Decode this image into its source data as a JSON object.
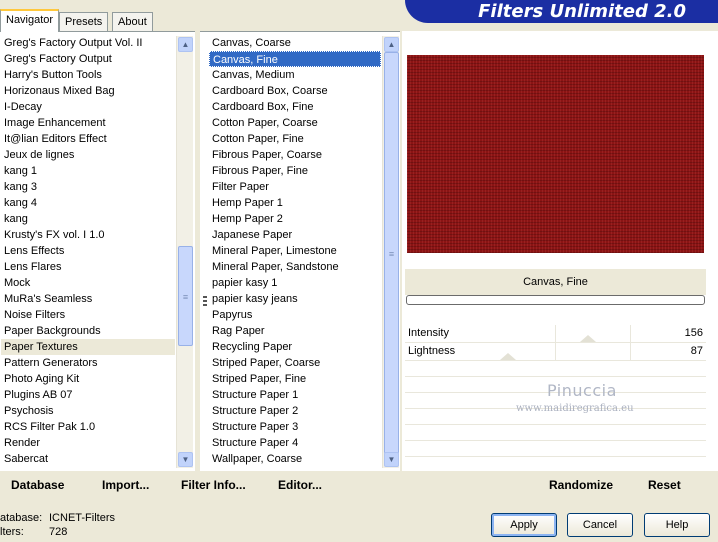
{
  "tabs": [
    "Navigator",
    "Presets",
    "About"
  ],
  "app_title": "Filters Unlimited 2.0",
  "categories": [
    "Greg's Factory Output Vol. II",
    "Greg's Factory Output",
    "Harry's Button Tools",
    "Horizonaus Mixed Bag",
    "I-Decay",
    "Image Enhancement",
    "It@lian Editors Effect",
    "Jeux de lignes",
    "kang 1",
    "kang 3",
    "kang 4",
    "kang",
    "Krusty's FX vol. I 1.0",
    "Lens Effects",
    "Lens Flares",
    "Mock",
    "MuRa's Seamless",
    "Noise Filters",
    "Paper Backgrounds",
    "Paper Textures",
    "Pattern Generators",
    "Photo Aging Kit",
    "Plugins AB 07",
    "Psychosis",
    "RCS Filter Pak 1.0",
    "Render",
    "Sabercat"
  ],
  "selected_category": "Paper Textures",
  "filters": [
    "Canvas, Coarse",
    "Canvas, Fine",
    "Canvas, Medium",
    "Cardboard Box, Coarse",
    "Cardboard Box, Fine",
    "Cotton Paper, Coarse",
    "Cotton Paper, Fine",
    "Fibrous Paper, Coarse",
    "Fibrous Paper, Fine",
    "Filter Paper",
    "Hemp Paper 1",
    "Hemp Paper 2",
    "Japanese Paper",
    "Mineral Paper, Limestone",
    "Mineral Paper, Sandstone",
    "papier kasy 1",
    "papier kasy jeans",
    "Papyrus",
    "Rag Paper",
    "Recycling Paper",
    "Striped Paper, Coarse",
    "Striped Paper, Fine",
    "Structure Paper 1",
    "Structure Paper 2",
    "Structure Paper 3",
    "Structure Paper 4",
    "Wallpaper, Coarse"
  ],
  "selected_filter": "Canvas, Fine",
  "preview": {
    "title": "Canvas, Fine",
    "texture_color": "#8b1414"
  },
  "sliders": [
    {
      "label": "Intensity",
      "value": "156"
    },
    {
      "label": "Lightness",
      "value": "87"
    }
  ],
  "watermark": {
    "line1": "Pinuccia",
    "line2": "www.maidiregrafica.eu"
  },
  "toolbar": {
    "database": "Database",
    "import": "Import...",
    "filter_info": "Filter Info...",
    "editor": "Editor...",
    "randomize": "Randomize",
    "reset": "Reset"
  },
  "status": {
    "database_label": "atabase:",
    "database_value": "ICNET-Filters",
    "filters_label": "lters:",
    "filters_value": "728"
  },
  "buttons": {
    "apply": "Apply",
    "cancel": "Cancel",
    "help": "Help"
  },
  "colors": {
    "selection": "#316ac5",
    "header": "#1b2ea3",
    "face": "#ece9d8"
  }
}
